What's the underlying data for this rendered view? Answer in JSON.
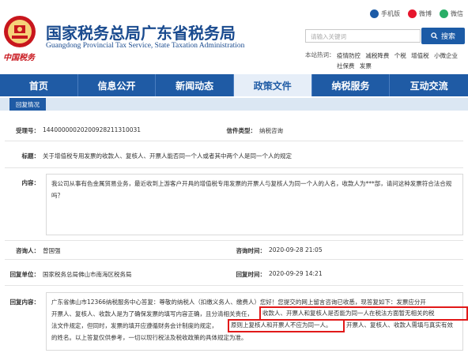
{
  "header": {
    "title_cn": "国家税务总局广东省税务局",
    "title_en": "Guangdong Provincial Tax Service, State Taxation Administration",
    "china_tax": "中国税务",
    "links": [
      {
        "label": "手机版",
        "icon": "mobile-icon",
        "color": "#1c5ba6"
      },
      {
        "label": "微博",
        "icon": "weibo-icon",
        "color": "#e6162d"
      },
      {
        "label": "微信",
        "icon": "wechat-icon",
        "color": "#2aae67"
      }
    ]
  },
  "search": {
    "placeholder": "请输入关键词",
    "button_label": "搜索",
    "hot_label": "本站热词：",
    "hot_words": [
      "疫情防控",
      "减税降费",
      "个税",
      "增值税",
      "小微企业",
      "社保费",
      "发票"
    ]
  },
  "nav": {
    "items": [
      "首页",
      "信息公开",
      "新闻动态",
      "政策文件",
      "纳税服务",
      "互动交流"
    ],
    "active_index": 3
  },
  "tab": {
    "label": "回复情况"
  },
  "record": {
    "id_label": "受理号：",
    "id_value": "14400000020200928211310031",
    "type_label": "信件类型：",
    "type_value": "纳税咨询",
    "subject_label": "标题：",
    "subject_value": "关于增值税专用发票的收款人、复核人、开票人能否同一个人或者其中两个人是同一个人的规定",
    "content_label": "内容：",
    "content_value": "我公司从事有色金属贸易业务，最近收到上游客户开具的增值税专用发票的开票人与复核人为同一个人的人名，收款人为***部，请问这种发票符合法合规吗？",
    "asker_label": "咨询人：",
    "asker_value": "曾国强",
    "ask_time_label": "咨询时间：",
    "ask_time_value": "2020-09-28 21:05",
    "reply_unit_label": "回复单位：",
    "reply_unit_value": "国家税务总局佛山市南海区税务局",
    "reply_time_label": "回复时间：",
    "reply_time_value": "2020-09-29 14:21",
    "reply_content_label": "回复内容：",
    "reply_line1": "广东省佛山市12366纳税服务中心答复：尊敬的纳税人（扣缴义务人、缴费人）您好！您提交的网上留言咨询已收悉，现答复如下：发票应分开",
    "reply_line2a": "开票人、复核人、收款人是为了确保发票的填写内容正确，且分清相关责任，",
    "reply_hl1": "收款人、开票人和复核人是否能为同一人在税法方面暂无相关的税",
    "reply_line3a": "法文件规定，但同时，发票的填开应遵循财务会计制度的规定，",
    "reply_hl2": "原则上复核人和开票人不应为同一人。",
    "reply_line3b": "开票人、复核人、收款人需填与真实有效",
    "reply_line4": "的姓名。以上答复仅供参考，一切以现行税法及税收政策的具体规定为准。"
  }
}
